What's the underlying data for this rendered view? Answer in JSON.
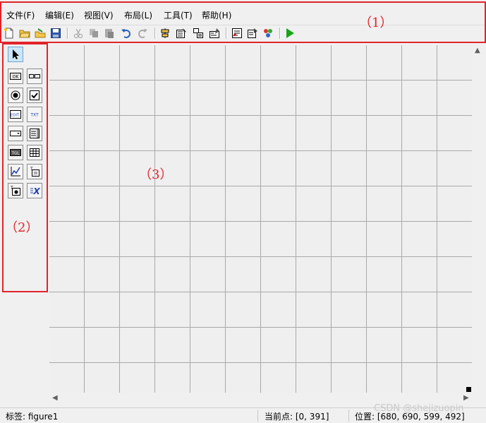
{
  "menu": {
    "items": [
      {
        "label": "文件(F)"
      },
      {
        "label": "编辑(E)"
      },
      {
        "label": "视图(V)"
      },
      {
        "label": "布局(L)"
      },
      {
        "label": "工具(T)"
      },
      {
        "label": "帮助(H)"
      }
    ]
  },
  "toolbar": {
    "buttons": [
      "new-icon",
      "open-icon",
      "open-recent-icon",
      "save-icon",
      "cut-icon",
      "copy-icon",
      "paste-icon",
      "undo-icon",
      "redo-icon",
      "align-icon",
      "menu-editor-icon",
      "tab-order-icon",
      "toolbar-editor-icon",
      "mfile-editor-icon",
      "property-inspector-icon",
      "object-browser-icon",
      "run-icon"
    ]
  },
  "palette": {
    "tools": [
      "select-tool",
      "push-button-tool",
      "slider-tool",
      "radio-button-tool",
      "checkbox-tool",
      "edit-text-tool",
      "static-text-tool",
      "popup-menu-tool",
      "listbox-tool",
      "toggle-button-tool",
      "table-tool",
      "axes-tool",
      "panel-tool",
      "button-group-tool",
      "activex-tool"
    ]
  },
  "annotations": {
    "label_1": "（1）",
    "label_2": "（2）",
    "label_3": "（3）",
    "color": "#e2232a"
  },
  "statusbar": {
    "tag": "标签: figure1",
    "current_point": "当前点:  [0, 391]",
    "position": "位置: [680, 690, 599, 492]"
  },
  "watermark": "CSDN @shejizuopin"
}
